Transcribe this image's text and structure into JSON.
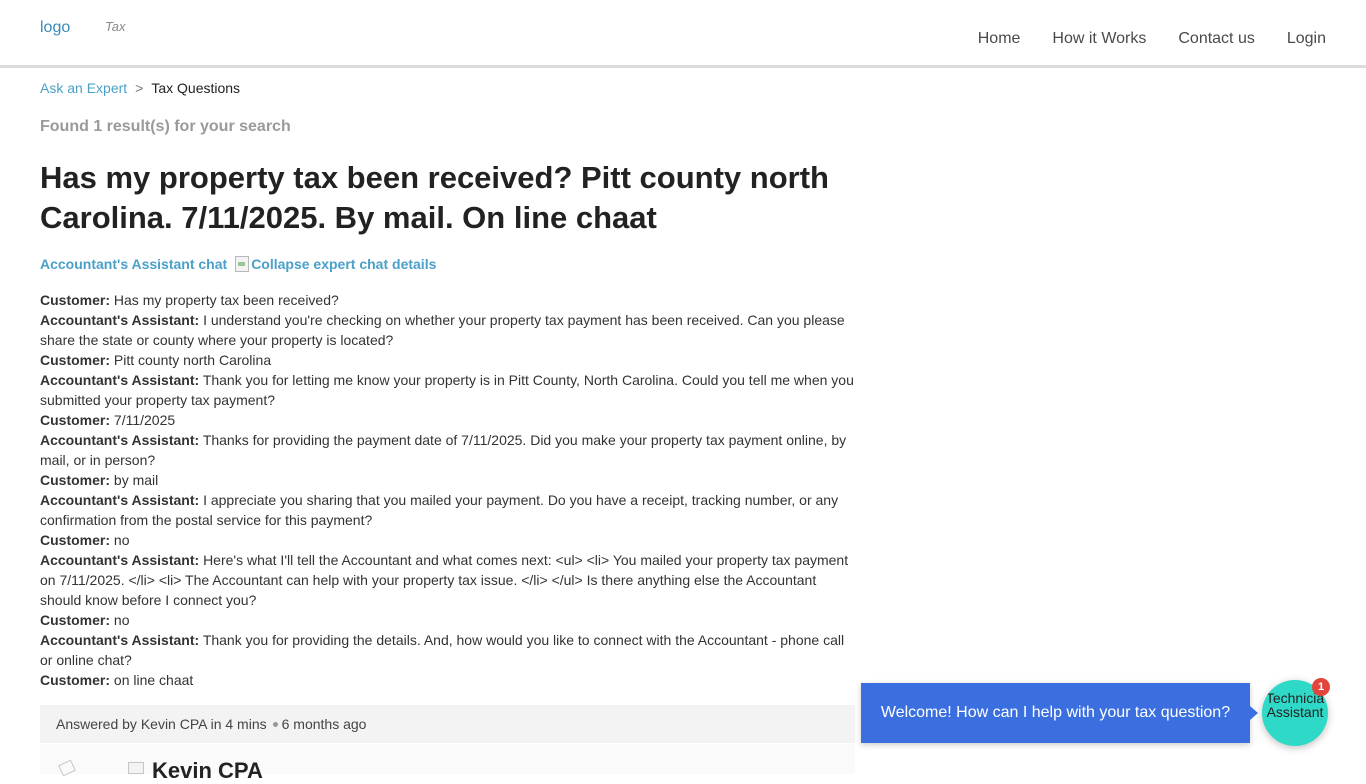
{
  "header": {
    "logo_alt": "logo",
    "logo_sub": "Tax",
    "nav": [
      "Home",
      "How it Works",
      "Contact us",
      "Login"
    ]
  },
  "breadcrumb": {
    "root": "Ask an Expert",
    "separator": ">",
    "current": "Tax Questions"
  },
  "search": {
    "found_text": "Found 1 result(s) for your search"
  },
  "question": {
    "title": "Has my property tax been received? Pitt county north Carolina. 7/11/2025. By mail. On line chaat"
  },
  "chat": {
    "heading": "Accountant's Assistant chat",
    "collapse_alt": "Collapse expert chat details",
    "transcript": [
      {
        "speaker": "Customer:",
        "text": "Has my property tax been received?"
      },
      {
        "speaker": "Accountant's Assistant:",
        "text": "I understand you're checking on whether your property tax payment has been received. Can you please share the state or county where your property is located?"
      },
      {
        "speaker": "Customer:",
        "text": "Pitt county north Carolina"
      },
      {
        "speaker": "Accountant's Assistant:",
        "text": "Thank you for letting me know your property is in Pitt County, North Carolina. Could you tell me when you submitted your property tax payment?"
      },
      {
        "speaker": "Customer:",
        "text": "7/11/2025"
      },
      {
        "speaker": "Accountant's Assistant:",
        "text": "Thanks for providing the payment date of 7/11/2025. Did you make your property tax payment online, by mail, or in person?"
      },
      {
        "speaker": "Customer:",
        "text": "by mail"
      },
      {
        "speaker": "Accountant's Assistant:",
        "text": "I appreciate you sharing that you mailed your payment. Do you have a receipt, tracking number, or any confirmation from the postal service for this payment?"
      },
      {
        "speaker": "Customer:",
        "text": "no"
      },
      {
        "speaker": "Accountant's Assistant:",
        "text": "Here's what I'll tell the Accountant and what comes next: <ul> <li> You mailed your property tax payment on 7/11/2025. </li> <li> The Accountant can help with your property tax issue. </li> </ul> Is there anything else the Accountant should know before I connect you?"
      },
      {
        "speaker": "Customer:",
        "text": "no"
      },
      {
        "speaker": "Accountant's Assistant:",
        "text": "Thank you for providing the details. And, how would you like to connect with the Accountant - phone call or online chat?"
      },
      {
        "speaker": "Customer:",
        "text": "on line chaat"
      }
    ]
  },
  "answer": {
    "answered_by": "Answered by Kevin CPA in 4 mins",
    "age": "6 months ago",
    "expert_name": "Kevin CPA"
  },
  "widget": {
    "welcome": "Welcome! How can I help with your tax question?",
    "bot_line1": "Technicia",
    "bot_line2": "Assistant",
    "badge_count": "1",
    "colors": {
      "bubble": "#3b6fe0",
      "bot": "#2fd9c8",
      "badge": "#e1453b"
    }
  }
}
